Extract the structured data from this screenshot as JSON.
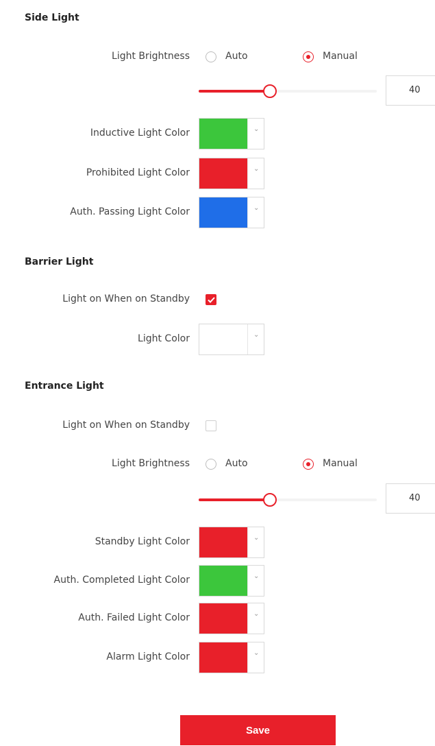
{
  "side_light": {
    "title": "Side Light",
    "brightness_label": "Light Brightness",
    "auto_label": "Auto",
    "manual_label": "Manual",
    "brightness_mode": "Manual",
    "brightness_value": "40",
    "slider_level": 0.4,
    "inductive_label": "Inductive Light Color",
    "inductive_color": "#3cc63c",
    "prohibited_label": "Prohibited Light Color",
    "prohibited_color": "#e8202a",
    "auth_passing_label": "Auth. Passing Light Color",
    "auth_passing_color": "#1f6ee8"
  },
  "barrier_light": {
    "title": "Barrier Light",
    "standby_label": "Light on When on Standby",
    "standby_checked": true,
    "light_color_label": "Light Color",
    "light_color": "#ffffff"
  },
  "entrance_light": {
    "title": "Entrance Light",
    "standby_label": "Light on When on Standby",
    "standby_checked": false,
    "brightness_label": "Light Brightness",
    "auto_label": "Auto",
    "manual_label": "Manual",
    "brightness_mode": "Manual",
    "brightness_value": "40",
    "slider_level": 0.4,
    "standby_color_label": "Standby Light Color",
    "standby_color": "#e8202a",
    "auth_completed_label": "Auth. Completed Light Color",
    "auth_completed_color": "#3cc63c",
    "auth_failed_label": "Auth. Failed Light Color",
    "auth_failed_color": "#e8202a",
    "alarm_label": "Alarm Light Color",
    "alarm_color": "#e8202a"
  },
  "actions": {
    "save_label": "Save",
    "accent_color": "#e8202a"
  },
  "icons": {
    "dropdown": "chevron-down-icon",
    "check": "check-icon"
  }
}
